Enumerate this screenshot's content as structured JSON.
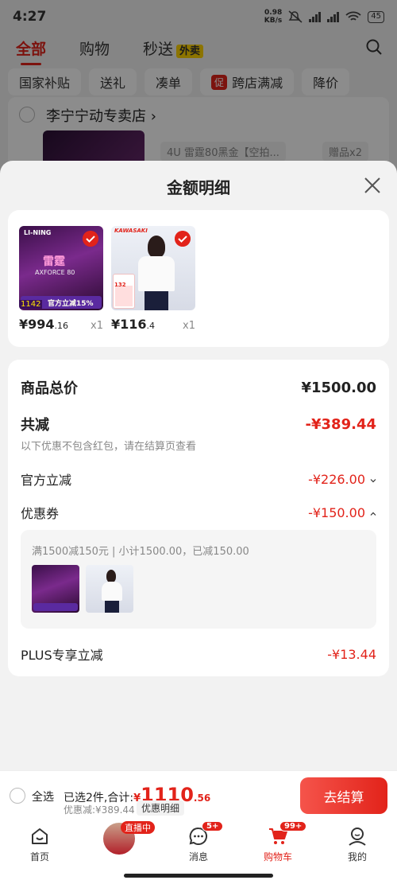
{
  "status_bar": {
    "time": "4:27",
    "net_speed_value": "0.98",
    "net_speed_unit": "KB/s",
    "battery": "45"
  },
  "top_tabs": [
    {
      "label": "全部"
    },
    {
      "label": "购物"
    },
    {
      "label": "秒送"
    }
  ],
  "waimai_badge": "外卖",
  "filter_chips": [
    {
      "label": "国家补贴"
    },
    {
      "label": "送礼"
    },
    {
      "label": "凑单"
    },
    {
      "label": "跨店满减",
      "promo": "促"
    },
    {
      "label": "降价"
    }
  ],
  "store": {
    "name": "李宁宁动专卖店",
    "spec": "4U 雷霆80黑金【空拍...",
    "gift": "赠品x2"
  },
  "sheet": {
    "title": "金额明细",
    "products": [
      {
        "price_int": "¥994",
        "price_dec": ".16",
        "qty": "x1",
        "img_title": "雷霆",
        "img_sub": "AXFORCE 80",
        "img_tag": "官方立减15%",
        "img_price": "1142",
        "brand": "LI-NING"
      },
      {
        "price_int": "¥116",
        "price_dec": ".4",
        "qty": "x1",
        "brand": "KAWASAKI",
        "tag_num": "132"
      }
    ],
    "total": {
      "label": "商品总价",
      "value": "¥1500.00"
    },
    "reduce": {
      "label": "共减",
      "value": "-¥389.44",
      "note": "以下优惠不包含红包，请在结算页查看"
    },
    "official": {
      "label": "官方立减",
      "value": "-¥226.00"
    },
    "coupon": {
      "label": "优惠券",
      "value": "-¥150.00",
      "desc": "满1500减150元 | 小计1500.00，已减150.00"
    },
    "plus": {
      "label": "PLUS专享立减",
      "value": "-¥13.44"
    }
  },
  "checkout": {
    "select_all": "全选",
    "summary_prefix": "已选2件,合计:",
    "yen": "¥",
    "amount_int": "1110",
    "amount_dec": ".56",
    "saved": "优惠减:¥389.44",
    "detail_btn": "优惠明细",
    "go_btn": "去结算"
  },
  "bottom_nav": [
    {
      "label": "首页",
      "icon": "home-icon"
    },
    {
      "label": "",
      "icon": "live-avatar",
      "badge": "直播中"
    },
    {
      "label": "消息",
      "icon": "message-icon",
      "badge": "5+"
    },
    {
      "label": "购物车",
      "icon": "cart-icon",
      "badge": "99+"
    },
    {
      "label": "我的",
      "icon": "profile-icon"
    }
  ],
  "colors": {
    "accent": "#e2231a",
    "background": "#f2f2f2"
  }
}
